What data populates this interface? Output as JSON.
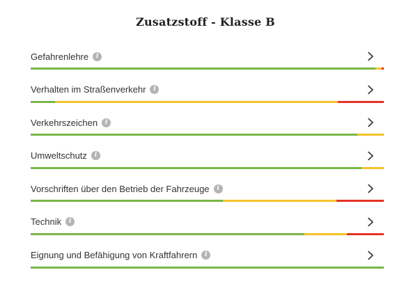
{
  "title": "Zusatzstoff - Klasse B",
  "colors": {
    "green": "#7ab648",
    "yellow": "#f5c22b",
    "red": "#e5332a"
  },
  "icons": {
    "info": "info-icon",
    "chevron": "chevron-right-icon"
  },
  "categories": [
    {
      "label": "Gefahrenlehre",
      "progress": {
        "green": 0.976,
        "yellow": 0.018,
        "red": 0.006
      }
    },
    {
      "label": "Verhalten im Straßenverkehr",
      "progress": {
        "green": 0.07,
        "yellow": 0.8,
        "red": 0.13
      }
    },
    {
      "label": "Verkehrszeichen",
      "progress": {
        "green": 0.925,
        "yellow": 0.075,
        "red": 0.0
      }
    },
    {
      "label": "Umweltschutz",
      "progress": {
        "green": 0.937,
        "yellow": 0.063,
        "red": 0.0
      }
    },
    {
      "label": "Vorschriften über den Betrieb der Fahrzeuge",
      "progress": {
        "green": 0.545,
        "yellow": 0.32,
        "red": 0.135
      }
    },
    {
      "label": "Technik",
      "progress": {
        "green": 0.775,
        "yellow": 0.12,
        "red": 0.105
      }
    },
    {
      "label": "Eignung und Befähigung von Kraftfahrern",
      "progress": {
        "green": 1.0,
        "yellow": 0.0,
        "red": 0.0
      }
    }
  ]
}
